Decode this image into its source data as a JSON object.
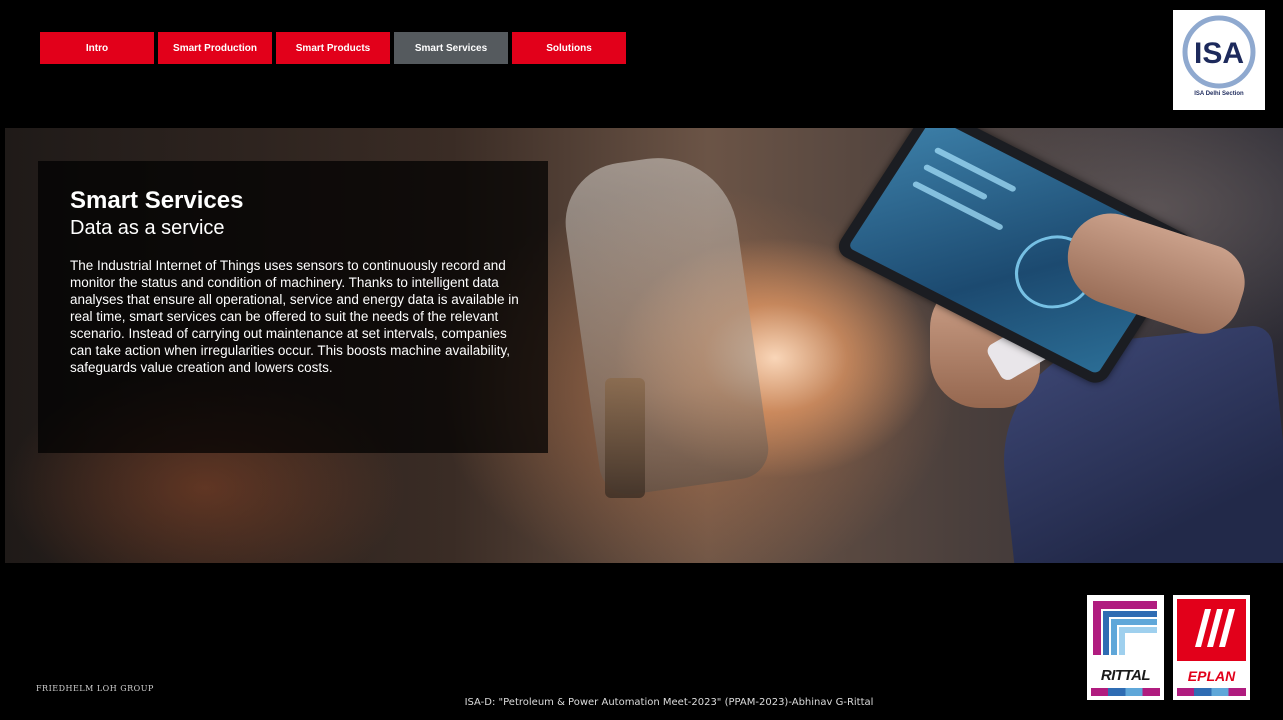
{
  "nav": {
    "tabs": [
      {
        "label": "Intro",
        "active": false
      },
      {
        "label": "Smart Production",
        "active": false
      },
      {
        "label": "Smart Products",
        "active": false
      },
      {
        "label": "Smart Services",
        "active": true
      },
      {
        "label": "Solutions",
        "active": false
      }
    ]
  },
  "logo": {
    "text": "ISA",
    "caption": "ISA Delhi Section"
  },
  "panel": {
    "title": "Smart Services",
    "subtitle": "Data as a service",
    "body": "The Industrial Internet of Things uses sensors to continuously record and monitor the status and condition of machinery. Thanks to intelligent data analyses that ensure all operational, service and energy data is available in real time, smart services can be offered to suit the needs of the relevant scenario. Instead of carrying out maintenance at set intervals, companies can take action when irregularities occur. This boosts machine availability, safeguards value creation and lowers costs."
  },
  "footer": {
    "left": "FRIEDHELM LOH GROUP",
    "center": "ISA-D: \"Petroleum & Power Automation Meet-2023\" (PPAM-2023)-Abhinav G-Rittal",
    "rittal": "RITTAL",
    "eplan": "EPLAN"
  },
  "colors": {
    "accent": "#e2001a",
    "active_tab": "#555a5e",
    "background": "#000000"
  }
}
